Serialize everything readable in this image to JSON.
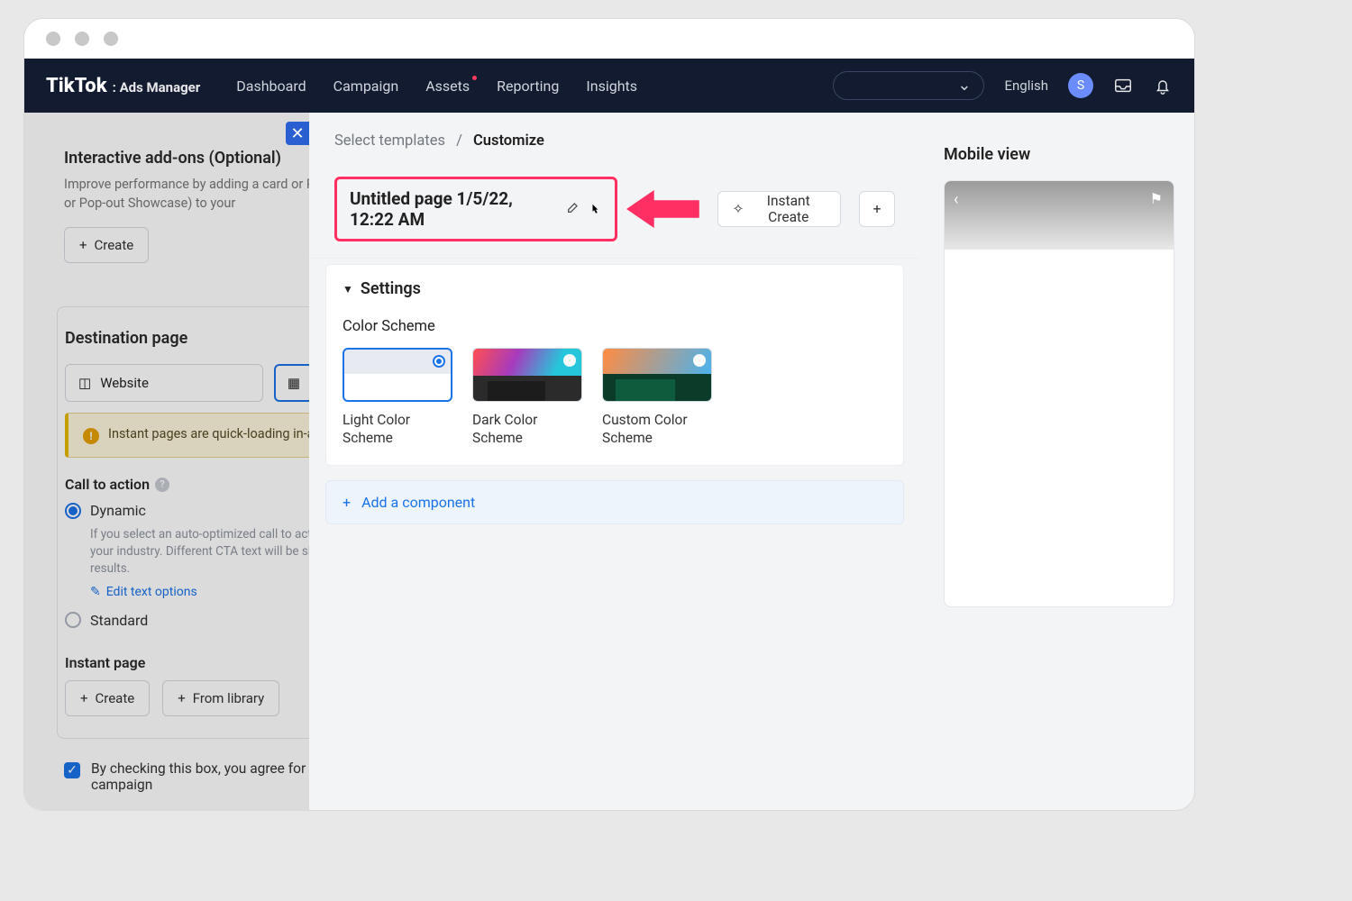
{
  "brand": {
    "main": "TikTok",
    "sub": ": Ads Manager"
  },
  "nav": {
    "items": [
      "Dashboard",
      "Campaign",
      "Assets",
      "Reporting",
      "Insights"
    ],
    "badge_index": 2
  },
  "topright": {
    "language": "English",
    "avatar_initial": "S"
  },
  "bg": {
    "addons": {
      "title": "Interactive add-ons (Optional)",
      "desc": "Improve performance by adding a card or Premium Interactive Gesture or Pop-out Showcase) to your",
      "create": "Create"
    },
    "dest": {
      "title": "Destination page",
      "website": "Website",
      "callout": "Instant pages are quick-loading in-app. Please note that instant page ads can only run on TikTok."
    },
    "cta": {
      "title": "Call to action",
      "dynamic": "Dynamic",
      "dynamic_hint": "If you select an auto-optimized call to action, CTA text for your ads based on your industry. Different CTA text will be shown to different users for optimal results.",
      "edit": "Edit text options",
      "standard": "Standard"
    },
    "instant": {
      "title": "Instant page",
      "create": "Create",
      "from_library": "From library"
    },
    "agree": "By checking this box, you agree for the performance metrics of the campaign"
  },
  "panel": {
    "breadcrumb": {
      "a": "Select templates",
      "b": "Customize"
    },
    "page_name": "Untitled page 1/5/22, 12:22 AM",
    "instant_create": "Instant Create",
    "settings_title": "Settings",
    "color_scheme_title": "Color Scheme",
    "schemes": {
      "light": "Light Color Scheme",
      "dark": "Dark Color Scheme",
      "custom": "Custom Color Scheme"
    },
    "selected_scheme": "light",
    "add_component": "Add a component"
  },
  "mobile": {
    "title": "Mobile view"
  },
  "icons": {
    "plus": "+",
    "site": "◫"
  }
}
